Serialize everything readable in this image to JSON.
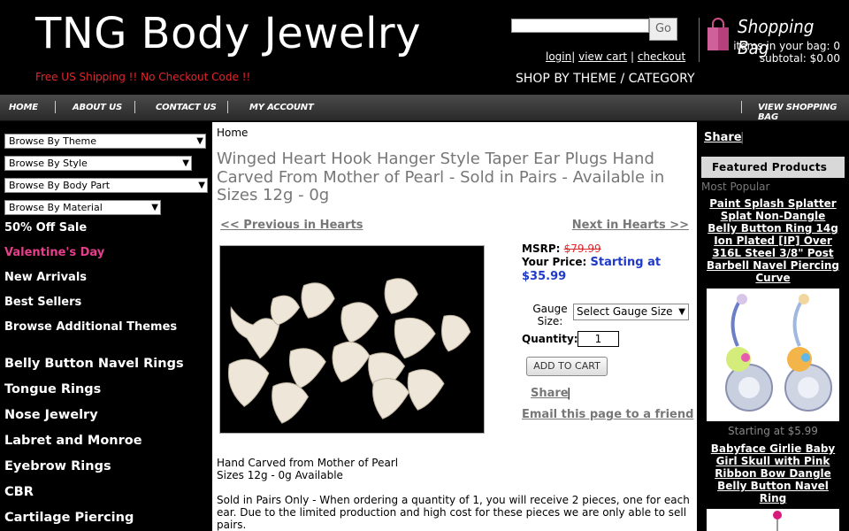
{
  "header": {
    "logo": "TNG Body Jewelry",
    "shipping_note": "Free US Shipping !! No Checkout Code !!",
    "search_button": "Go",
    "links": [
      "login",
      "view cart",
      "checkout"
    ],
    "shop_by": "SHOP BY THEME / CATEGORY",
    "bag_title": "Shopping Bag",
    "bag_count": "items in your bag: 0",
    "bag_subtotal": "subtotal: $0.00"
  },
  "nav": {
    "home": "HOME",
    "about": "ABOUT US",
    "contact": "CONTACT US",
    "account": "MY ACCOUNT",
    "view_bag": "VIEW SHOPPING BAG"
  },
  "sidebar": {
    "selects": [
      "Browse By Theme",
      "Browse By Style",
      "Browse By Body Part",
      "Browse By Material"
    ],
    "links": [
      "50% Off Sale",
      "Valentine's Day",
      "New Arrivals",
      "Best Sellers",
      "Browse Additional Themes"
    ],
    "categories": [
      "Belly Button Navel Rings",
      "Tongue Rings",
      "Nose Jewelry",
      "Labret and Monroe",
      "Eyebrow Rings",
      "CBR",
      "Cartilage Piercing"
    ]
  },
  "main": {
    "breadcrumb": "Home",
    "title": "Winged Heart Hook Hanger Style Taper Ear Plugs Hand Carved From Mother of Pearl - Sold in Pairs - Available in Sizes 12g - 0g",
    "prev": "<< Previous in Hearts",
    "next": "Next in Hearts >>",
    "msrp_label": "MSRP:",
    "msrp_value": "$79.99",
    "price_label": "Your Price:",
    "price_value": "Starting at $35.99",
    "gauge_label": "Gauge Size:",
    "gauge_select": "Select Gauge Size",
    "qty_label": "Quantity:",
    "qty_value": "1",
    "add_to_cart": "ADD TO CART",
    "share": "Share",
    "share_sep": "|",
    "email_friend": "Email this page to a friend",
    "desc1": "Hand Carved from Mother of Pearl",
    "desc2": "Sizes 12g - 0g Available",
    "desc3": "Sold in Pairs Only - When ordering a quantity of 1, you will receive 2 pieces, one for each ear.  Due to the limited production and high cost for these pieces we are only able to sell pairs."
  },
  "right": {
    "share": "Share",
    "share_sep": "|",
    "featured": "Featured Products",
    "most_popular": "Most Popular",
    "item1_name": "Paint Splash Splatter Splat Non-Dangle Belly Button Ring 14g Ion Plated [IP] Over 316L Steel 3/8\" Post Barbell Navel Piercing Curve",
    "item1_price": "Starting at $5.99",
    "item2_name": "Babyface Girlie Baby Girl Skull with Pink Ribbon Bow Dangle Belly Button Navel Ring"
  }
}
